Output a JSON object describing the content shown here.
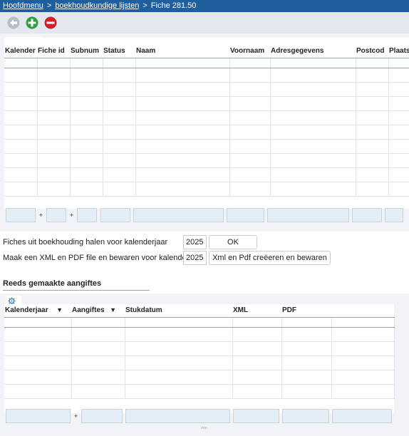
{
  "breadcrumb": {
    "home": "Hoofdmenu",
    "sep1": ">",
    "lists": "boekhoudkundige lijsten",
    "sep2": ">",
    "current": "Fiche 281.50"
  },
  "toolbar": {
    "back_icon": "arrow-left-icon",
    "add_icon": "plus-icon",
    "remove_icon": "minus-icon"
  },
  "grid1": {
    "icons": [
      "gear-icon",
      "refresh-icon",
      "excel-icon"
    ],
    "columns": [
      "Kalender",
      "Fiche id",
      "Subnum",
      "Status",
      "Naam",
      "Voornaam",
      "Adresgegevens",
      "Postcod",
      "Plaats"
    ],
    "plus": "+"
  },
  "actions": {
    "fetch_label": "Fiches uit boekhouding halen voor kalenderjaar",
    "fetch_year": "2025",
    "fetch_button": "OK",
    "xml_label": "Maak een XML en PDF file en bewaren voor kalenderjaar",
    "xml_year": "2025",
    "xml_button": "Xml en Pdf creëeren en bewaren"
  },
  "section": {
    "title": "Reeds gemaakte aangiftes"
  },
  "grid2": {
    "icons": [
      "gear-icon"
    ],
    "columns": [
      "Kalenderjaar",
      "Aangiftes",
      "Stukdatum",
      "XML",
      "PDF",
      ""
    ],
    "sort_arrow": "▼",
    "plus": "+"
  },
  "footer": {
    "resize_handle": "^^^"
  },
  "colors": {
    "topbar": "#1f5f9e",
    "add": "#2e9e3e",
    "remove": "#d0202a"
  }
}
